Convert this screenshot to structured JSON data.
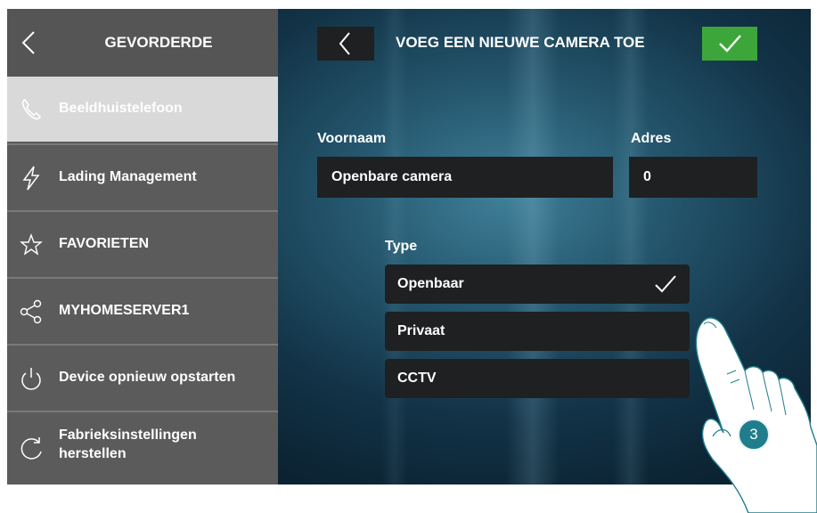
{
  "sidebar": {
    "title": "GEVORDERDE",
    "items": [
      {
        "label": "Beeldhuistelefoon",
        "icon": "phone-icon",
        "active": true
      },
      {
        "label": "Lading Management",
        "icon": "lightning-icon"
      },
      {
        "label": "FAVORIETEN",
        "icon": "star-icon"
      },
      {
        "label": "MYHOMESERVER1",
        "icon": "share-icon"
      },
      {
        "label": "Device opnieuw opstarten",
        "icon": "power-icon"
      },
      {
        "label": "Fabrieksinstellingen herstellen",
        "icon": "reset-icon"
      }
    ]
  },
  "header": {
    "title": "VOEG EEN NIEUWE CAMERA TOE"
  },
  "form": {
    "name_label": "Voornaam",
    "name_value": "Openbare camera",
    "address_label": "Adres",
    "address_value": "0",
    "type_label": "Type",
    "type_options": [
      {
        "label": "Openbaar",
        "selected": true
      },
      {
        "label": "Privaat",
        "selected": false
      },
      {
        "label": "CCTV",
        "selected": false
      }
    ]
  },
  "step_badge": "3",
  "colors": {
    "accent_green": "#3da63a",
    "sidebar_bg": "#5b5b5b",
    "sidebar_active": "#d9d9d9",
    "field_bg": "#1f2021",
    "background": "#24566d"
  }
}
